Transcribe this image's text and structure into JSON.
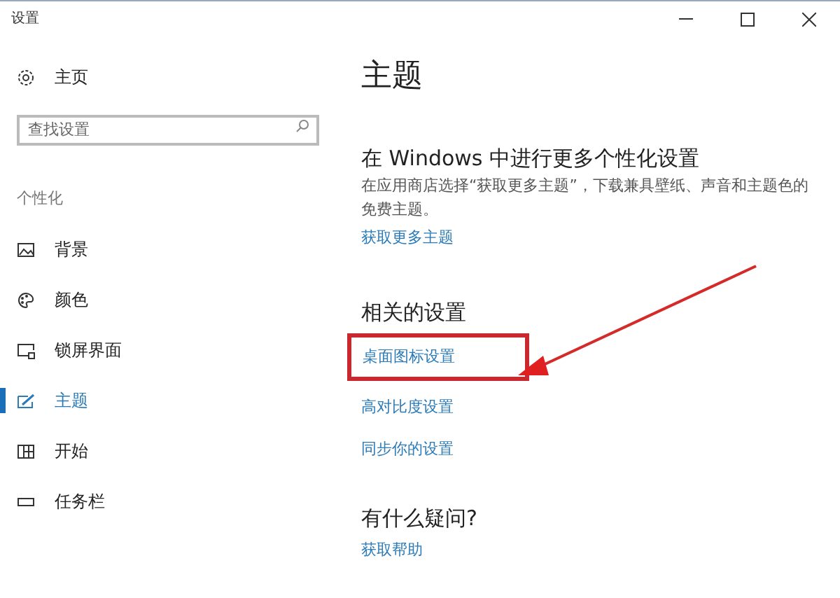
{
  "window": {
    "title": "设置"
  },
  "sidebar": {
    "home": "主页",
    "search": {
      "placeholder": "查找设置"
    },
    "section": "个性化",
    "items": [
      {
        "label": "背景",
        "selected": false
      },
      {
        "label": "颜色",
        "selected": false
      },
      {
        "label": "锁屏界面",
        "selected": false
      },
      {
        "label": "主题",
        "selected": true
      },
      {
        "label": "开始",
        "selected": false
      },
      {
        "label": "任务栏",
        "selected": false
      }
    ]
  },
  "main": {
    "title": "主题",
    "sections": [
      {
        "heading": "在 Windows 中进行更多个性化设置",
        "description": "在应用商店选择“获取更多主题”，下载兼具壁纸、声音和主题色的免费主题。",
        "links": [
          {
            "label": "获取更多主题",
            "highlighted": false
          }
        ]
      },
      {
        "heading": "相关的设置",
        "links": [
          {
            "label": "桌面图标设置",
            "highlighted": true
          },
          {
            "label": "高对比度设置",
            "highlighted": false
          },
          {
            "label": "同步你的设置",
            "highlighted": false
          }
        ]
      },
      {
        "heading": "有什么疑问?",
        "links": [
          {
            "label": "获取帮助",
            "highlighted": false
          }
        ]
      }
    ]
  }
}
